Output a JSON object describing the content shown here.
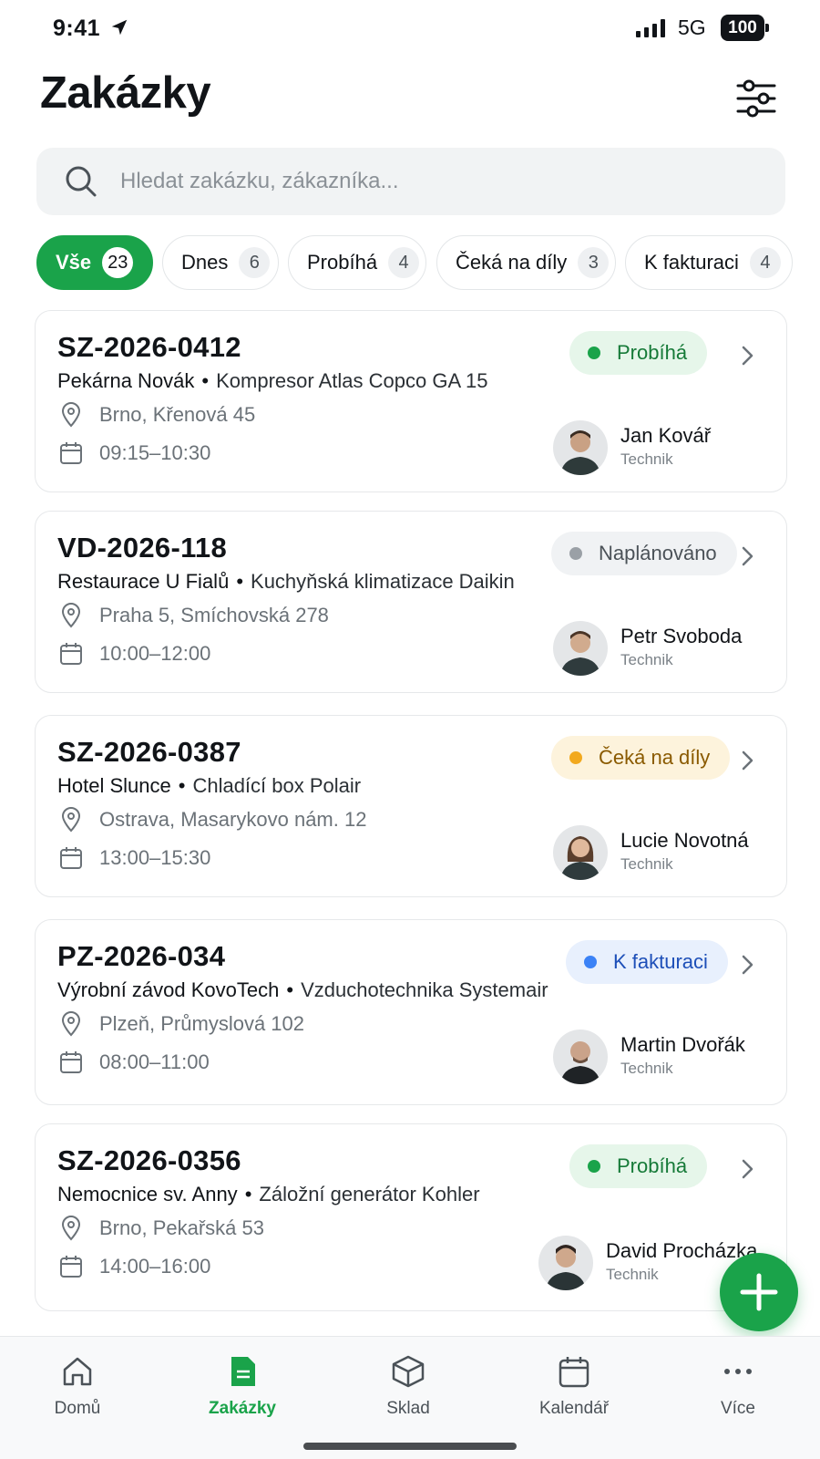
{
  "status_bar": {
    "time": "9:41",
    "network": "5G",
    "battery": "100"
  },
  "header": {
    "title": "Zakázky",
    "filter_icon": "sliders-icon"
  },
  "search": {
    "placeholder": "Hledat zakázku, zákazníka..."
  },
  "filters": [
    {
      "label": "Vše",
      "count": "23",
      "active": true
    },
    {
      "label": "Dnes",
      "count": "6",
      "active": false
    },
    {
      "label": "Probíhá",
      "count": "4",
      "active": false
    },
    {
      "label": "Čeká na díly",
      "count": "3",
      "active": false
    },
    {
      "label": "K fakturaci",
      "count": "4",
      "active": false
    }
  ],
  "orders": [
    {
      "id": "SZ-2026-0412",
      "customer": "Pekárna Novák",
      "device": "Kompresor Atlas Copco GA 15",
      "address": "Brno, Křenová 45",
      "time": "09:15–10:30",
      "status": "Probíhá",
      "status_color": "#1aa34a",
      "status_bg": "#e6f6ea",
      "status_text": "#167a38",
      "technician": "Jan Kovář",
      "role": "Technik"
    },
    {
      "id": "VD-2026-118",
      "customer": "Restaurace U Fialů",
      "device": "Kuchyňská klimatizace Daikin",
      "address": "Praha 5, Smíchovská 278",
      "time": "10:00–12:00",
      "status": "Naplánováno",
      "status_color": "#9aa0a6",
      "status_bg": "#f0f2f4",
      "status_text": "#4b5258",
      "technician": "Petr Svoboda",
      "role": "Technik"
    },
    {
      "id": "SZ-2026-0387",
      "customer": "Hotel Slunce",
      "device": "Chladící box Polair",
      "address": "Ostrava, Masarykovo nám. 12",
      "time": "13:00–15:30",
      "status": "Čeká na díly",
      "status_color": "#f2a91e",
      "status_bg": "#fdf3dc",
      "status_text": "#8a5a00",
      "technician": "Lucie Novotná",
      "role": "Technik"
    },
    {
      "id": "PZ-2026-034",
      "customer": "Výrobní závod KovoTech",
      "device": "Vzduchotechnika Systemair",
      "address": "Plzeň, Průmyslová 102",
      "time": "08:00–11:00",
      "status": "K fakturaci",
      "status_color": "#3b82f6",
      "status_bg": "#e8f0fd",
      "status_text": "#1d4fb8",
      "technician": "Martin Dvořák",
      "role": "Technik"
    },
    {
      "id": "SZ-2026-0356",
      "customer": "Nemocnice sv. Anny",
      "device": "Záložní generátor Kohler",
      "address": "Brno, Pekařská 53",
      "time": "14:00–16:00",
      "status": "Probíhá",
      "status_color": "#1aa34a",
      "status_bg": "#e6f6ea",
      "status_text": "#167a38",
      "technician": "David Procházka",
      "role": "Technik"
    }
  ],
  "bottom_nav": [
    {
      "label": "Domů",
      "icon": "home-icon",
      "active": false
    },
    {
      "label": "Zakázky",
      "icon": "document-icon",
      "active": true
    },
    {
      "label": "Sklad",
      "icon": "box-icon",
      "active": false
    },
    {
      "label": "Kalendář",
      "icon": "calendar-icon",
      "active": false
    },
    {
      "label": "Více",
      "icon": "more-icon",
      "active": false
    }
  ],
  "colors": {
    "accent": "#1aa34a"
  }
}
